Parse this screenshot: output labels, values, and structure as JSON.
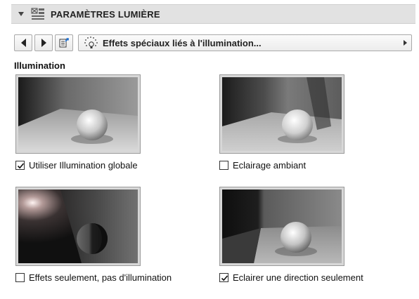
{
  "header": {
    "title": "PARAMÈTRES LUMIÈRE",
    "icon": "light-settings-icon"
  },
  "toolbar": {
    "prev_icon": "arrow-left-icon",
    "next_icon": "arrow-right-icon",
    "settings_icon": "document-settings-icon",
    "dropdown": {
      "icon": "light-effects-icon",
      "selected": "Effets spéciaux liés à l'illumination..."
    }
  },
  "section": {
    "label": "Illumination"
  },
  "options": [
    {
      "label": "Utiliser Illumination globale",
      "checked": true
    },
    {
      "label": "Eclairage ambiant",
      "checked": false
    },
    {
      "label": "Effets seulement, pas d'illumination",
      "checked": false
    },
    {
      "label": "Eclairer une direction seulement",
      "checked": true
    }
  ],
  "colors": {
    "header_bg": "#e2e2e2",
    "panel_bg": "#ffffff",
    "border": "#a9a9a9"
  }
}
